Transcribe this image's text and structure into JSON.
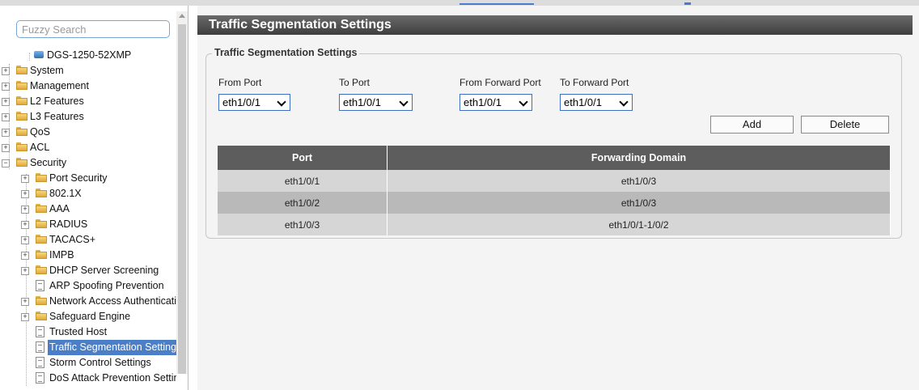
{
  "search": {
    "placeholder": "Fuzzy Search"
  },
  "tree": [
    {
      "label": "DGS-1250-52XMP",
      "type": "device"
    },
    {
      "label": "System",
      "type": "folder"
    },
    {
      "label": "Management",
      "type": "folder"
    },
    {
      "label": "L2 Features",
      "type": "folder"
    },
    {
      "label": "L3 Features",
      "type": "folder"
    },
    {
      "label": "QoS",
      "type": "folder"
    },
    {
      "label": "ACL",
      "type": "folder"
    },
    {
      "label": "Security",
      "type": "folder-open"
    },
    {
      "label": "Port Security",
      "type": "folder"
    },
    {
      "label": "802.1X",
      "type": "folder"
    },
    {
      "label": "AAA",
      "type": "folder"
    },
    {
      "label": "RADIUS",
      "type": "folder"
    },
    {
      "label": "TACACS+",
      "type": "folder"
    },
    {
      "label": "IMPB",
      "type": "folder"
    },
    {
      "label": "DHCP Server Screening",
      "type": "folder"
    },
    {
      "label": "ARP Spoofing Prevention",
      "type": "page"
    },
    {
      "label": "Network Access Authentication",
      "type": "folder"
    },
    {
      "label": "Safeguard Engine",
      "type": "folder"
    },
    {
      "label": "Trusted Host",
      "type": "page"
    },
    {
      "label": "Traffic Segmentation Settings",
      "type": "page",
      "selected": true
    },
    {
      "label": "Storm Control Settings",
      "type": "page"
    },
    {
      "label": "DoS Attack Prevention Settings",
      "type": "page"
    }
  ],
  "page": {
    "title": "Traffic Segmentation Settings"
  },
  "form": {
    "legend": "Traffic Segmentation Settings",
    "from_port_label": "From Port",
    "to_port_label": "To Port",
    "from_forward_port_label": "From Forward Port",
    "to_forward_port_label": "To Forward Port",
    "from_port_value": "eth1/0/1",
    "to_port_value": "eth1/0/1",
    "from_forward_port_value": "eth1/0/1",
    "to_forward_port_value": "eth1/0/1",
    "add_label": "Add",
    "delete_label": "Delete"
  },
  "table": {
    "headers": [
      "Port",
      "Forwarding Domain"
    ],
    "rows": [
      [
        "eth1/0/1",
        "eth1/0/3"
      ],
      [
        "eth1/0/2",
        "eth1/0/3"
      ],
      [
        "eth1/0/3",
        "eth1/0/1-1/0/2"
      ]
    ]
  },
  "colors": {
    "accent": "#4a7fc8",
    "title_bar": "#4a4a4a",
    "table_header": "#5d5d5d"
  }
}
